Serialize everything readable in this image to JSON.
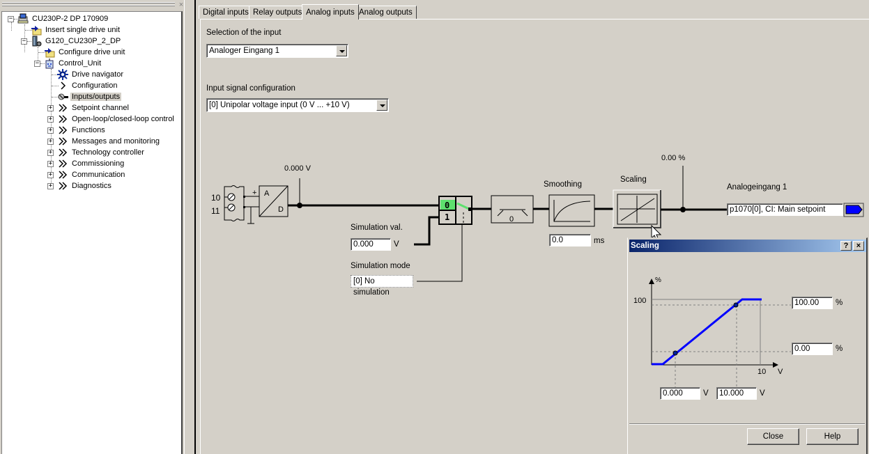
{
  "left_panel": {
    "close_label": "×",
    "tree": [
      {
        "label": "CU230P-2 DP 170909",
        "icon": "project-icon",
        "level": 0,
        "expander": "minus"
      },
      {
        "label": "Insert single drive unit",
        "icon": "insert-folder-icon",
        "level": 1,
        "expander": null
      },
      {
        "label": "G120_CU230P_2_DP",
        "icon": "drive-unit-icon",
        "level": 1,
        "expander": "minus"
      },
      {
        "label": "Configure drive unit",
        "icon": "configure-folder-icon",
        "level": 2,
        "expander": null
      },
      {
        "label": "Control_Unit",
        "icon": "control-unit-icon",
        "level": 2,
        "expander": "minus"
      },
      {
        "label": "Drive navigator",
        "icon": "navigator-gear-icon",
        "level": 3,
        "expander": null
      },
      {
        "label": "Configuration",
        "icon": "chevron-right-icon",
        "level": 3,
        "expander": null
      },
      {
        "label": "Inputs/outputs",
        "icon": "io-plug-icon",
        "level": 3,
        "expander": null,
        "selected": true
      },
      {
        "label": "Setpoint channel",
        "icon": "double-chevron-icon",
        "level": 3,
        "expander": "plus"
      },
      {
        "label": "Open-loop/closed-loop control",
        "icon": "double-chevron-icon",
        "level": 3,
        "expander": "plus"
      },
      {
        "label": "Functions",
        "icon": "double-chevron-icon",
        "level": 3,
        "expander": "plus"
      },
      {
        "label": "Messages and monitoring",
        "icon": "double-chevron-icon",
        "level": 3,
        "expander": "plus"
      },
      {
        "label": "Technology controller",
        "icon": "double-chevron-icon",
        "level": 3,
        "expander": "plus"
      },
      {
        "label": "Commissioning",
        "icon": "double-chevron-icon",
        "level": 3,
        "expander": "plus"
      },
      {
        "label": "Communication",
        "icon": "double-chevron-icon",
        "level": 3,
        "expander": "plus"
      },
      {
        "label": "Diagnostics",
        "icon": "double-chevron-icon",
        "level": 3,
        "expander": "plus"
      }
    ]
  },
  "tabs": [
    {
      "label": "Digital inputs",
      "active": false
    },
    {
      "label": "Relay outputs",
      "active": false
    },
    {
      "label": "Analog inputs",
      "active": true
    },
    {
      "label": "Analog outputs",
      "active": false
    }
  ],
  "analog_inputs": {
    "selection_label": "Selection of the input",
    "selection_value": "Analoger Eingang 1",
    "signal_config_label": "Input signal configuration",
    "signal_config_value": "[0] Unipolar voltage input (0 V ... +10 V)",
    "terminals": [
      "10",
      "11"
    ],
    "terminal_plus": "+",
    "terminal_minus": "-",
    "adc_a": "A",
    "adc_d": "D",
    "input_voltage": "0.000 V",
    "switch_pos0": "0",
    "switch_pos1": "1",
    "simulation_value_label": "Simulation val.",
    "simulation_value": "0.000",
    "simulation_value_unit": "V",
    "simulation_mode_label": "Simulation mode",
    "simulation_mode_value": "[0] No simulation",
    "deadband_label": "0",
    "smoothing_label": "Smoothing",
    "smoothing_value": "0.0",
    "smoothing_unit": "ms",
    "scaling_label": "Scaling",
    "output_percent": "0.00 %",
    "output_name": "Analogeingang 1",
    "output_connector": "p1070[0], CI: Main setpoint"
  },
  "scaling_dialog": {
    "title": "Scaling",
    "help_btn": "?",
    "close_btn": "×",
    "y_axis_unit": "%",
    "x_axis_unit": "V",
    "y_tick_100": "100",
    "x_tick_10": "10",
    "y2_value": "100.00",
    "y2_unit": "%",
    "y1_value": "0.00",
    "y1_unit": "%",
    "x1_value": "0.000",
    "x1_unit": "V",
    "x2_value": "10.000",
    "x2_unit": "V",
    "close_label": "Close",
    "help_label": "Help"
  },
  "colors": {
    "switch_active": "#5ee06e",
    "curve": "#0000ff",
    "title_start": "#0a246a",
    "title_end": "#a6caf0",
    "connector_arrow": "#0000ff"
  }
}
